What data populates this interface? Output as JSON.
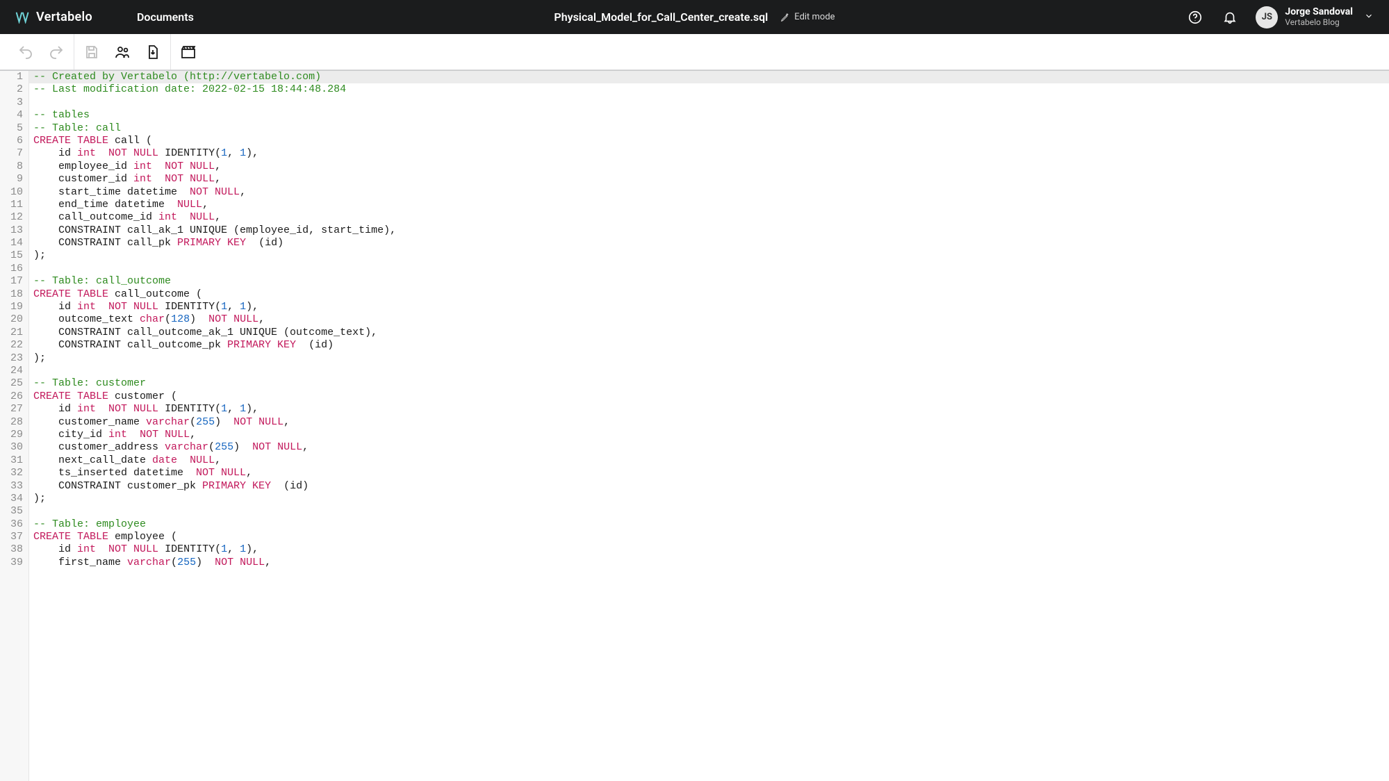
{
  "brand": "Vertabelo",
  "nav": {
    "documents": "Documents"
  },
  "header": {
    "doc_title": "Physical_Model_for_Call_Center_create.sql",
    "edit_mode_label": "Edit mode"
  },
  "user": {
    "avatar_initials": "JS",
    "name": "Jorge Sandoval",
    "subtitle": "Vertabelo Blog"
  },
  "icons": {
    "help": "help-circle-icon",
    "notifications": "bell-icon",
    "undo": "undo-icon",
    "redo": "redo-icon",
    "save": "save-icon",
    "share": "share-users-icon",
    "download": "download-icon",
    "film": "film-icon",
    "pencil": "pencil-icon",
    "chevron": "chevron-down-icon"
  },
  "editor": {
    "active_line": 1,
    "lines": [
      {
        "n": 1,
        "tokens": [
          {
            "c": "comment",
            "t": "-- Created by Vertabelo (http://vertabelo.com)"
          }
        ]
      },
      {
        "n": 2,
        "tokens": [
          {
            "c": "comment",
            "t": "-- Last modification date: 2022-02-15 18:44:48.284"
          }
        ]
      },
      {
        "n": 3,
        "tokens": [
          {
            "c": "plain",
            "t": ""
          }
        ]
      },
      {
        "n": 4,
        "tokens": [
          {
            "c": "comment",
            "t": "-- tables"
          }
        ]
      },
      {
        "n": 5,
        "tokens": [
          {
            "c": "comment",
            "t": "-- Table: call"
          }
        ]
      },
      {
        "n": 6,
        "tokens": [
          {
            "c": "keyword",
            "t": "CREATE TABLE"
          },
          {
            "c": "plain",
            "t": " call ("
          }
        ]
      },
      {
        "n": 7,
        "tokens": [
          {
            "c": "plain",
            "t": "    id "
          },
          {
            "c": "type",
            "t": "int"
          },
          {
            "c": "plain",
            "t": "  "
          },
          {
            "c": "keyword",
            "t": "NOT NULL"
          },
          {
            "c": "plain",
            "t": " IDENTITY("
          },
          {
            "c": "num",
            "t": "1"
          },
          {
            "c": "plain",
            "t": ", "
          },
          {
            "c": "num",
            "t": "1"
          },
          {
            "c": "plain",
            "t": "),"
          }
        ]
      },
      {
        "n": 8,
        "tokens": [
          {
            "c": "plain",
            "t": "    employee_id "
          },
          {
            "c": "type",
            "t": "int"
          },
          {
            "c": "plain",
            "t": "  "
          },
          {
            "c": "keyword",
            "t": "NOT NULL"
          },
          {
            "c": "plain",
            "t": ","
          }
        ]
      },
      {
        "n": 9,
        "tokens": [
          {
            "c": "plain",
            "t": "    customer_id "
          },
          {
            "c": "type",
            "t": "int"
          },
          {
            "c": "plain",
            "t": "  "
          },
          {
            "c": "keyword",
            "t": "NOT NULL"
          },
          {
            "c": "plain",
            "t": ","
          }
        ]
      },
      {
        "n": 10,
        "tokens": [
          {
            "c": "plain",
            "t": "    start_time datetime  "
          },
          {
            "c": "keyword",
            "t": "NOT NULL"
          },
          {
            "c": "plain",
            "t": ","
          }
        ]
      },
      {
        "n": 11,
        "tokens": [
          {
            "c": "plain",
            "t": "    end_time datetime  "
          },
          {
            "c": "keyword",
            "t": "NULL"
          },
          {
            "c": "plain",
            "t": ","
          }
        ]
      },
      {
        "n": 12,
        "tokens": [
          {
            "c": "plain",
            "t": "    call_outcome_id "
          },
          {
            "c": "type",
            "t": "int"
          },
          {
            "c": "plain",
            "t": "  "
          },
          {
            "c": "keyword",
            "t": "NULL"
          },
          {
            "c": "plain",
            "t": ","
          }
        ]
      },
      {
        "n": 13,
        "tokens": [
          {
            "c": "plain",
            "t": "    CONSTRAINT call_ak_1 UNIQUE (employee_id, start_time),"
          }
        ]
      },
      {
        "n": 14,
        "tokens": [
          {
            "c": "plain",
            "t": "    CONSTRAINT call_pk "
          },
          {
            "c": "keyword",
            "t": "PRIMARY KEY"
          },
          {
            "c": "plain",
            "t": "  (id)"
          }
        ]
      },
      {
        "n": 15,
        "tokens": [
          {
            "c": "plain",
            "t": ");"
          }
        ]
      },
      {
        "n": 16,
        "tokens": [
          {
            "c": "plain",
            "t": ""
          }
        ]
      },
      {
        "n": 17,
        "tokens": [
          {
            "c": "comment",
            "t": "-- Table: call_outcome"
          }
        ]
      },
      {
        "n": 18,
        "tokens": [
          {
            "c": "keyword",
            "t": "CREATE TABLE"
          },
          {
            "c": "plain",
            "t": " call_outcome ("
          }
        ]
      },
      {
        "n": 19,
        "tokens": [
          {
            "c": "plain",
            "t": "    id "
          },
          {
            "c": "type",
            "t": "int"
          },
          {
            "c": "plain",
            "t": "  "
          },
          {
            "c": "keyword",
            "t": "NOT NULL"
          },
          {
            "c": "plain",
            "t": " IDENTITY("
          },
          {
            "c": "num",
            "t": "1"
          },
          {
            "c": "plain",
            "t": ", "
          },
          {
            "c": "num",
            "t": "1"
          },
          {
            "c": "plain",
            "t": "),"
          }
        ]
      },
      {
        "n": 20,
        "tokens": [
          {
            "c": "plain",
            "t": "    outcome_text "
          },
          {
            "c": "type",
            "t": "char"
          },
          {
            "c": "plain",
            "t": "("
          },
          {
            "c": "num",
            "t": "128"
          },
          {
            "c": "plain",
            "t": ")  "
          },
          {
            "c": "keyword",
            "t": "NOT NULL"
          },
          {
            "c": "plain",
            "t": ","
          }
        ]
      },
      {
        "n": 21,
        "tokens": [
          {
            "c": "plain",
            "t": "    CONSTRAINT call_outcome_ak_1 UNIQUE (outcome_text),"
          }
        ]
      },
      {
        "n": 22,
        "tokens": [
          {
            "c": "plain",
            "t": "    CONSTRAINT call_outcome_pk "
          },
          {
            "c": "keyword",
            "t": "PRIMARY KEY"
          },
          {
            "c": "plain",
            "t": "  (id)"
          }
        ]
      },
      {
        "n": 23,
        "tokens": [
          {
            "c": "plain",
            "t": ");"
          }
        ]
      },
      {
        "n": 24,
        "tokens": [
          {
            "c": "plain",
            "t": ""
          }
        ]
      },
      {
        "n": 25,
        "tokens": [
          {
            "c": "comment",
            "t": "-- Table: customer"
          }
        ]
      },
      {
        "n": 26,
        "tokens": [
          {
            "c": "keyword",
            "t": "CREATE TABLE"
          },
          {
            "c": "plain",
            "t": " customer ("
          }
        ]
      },
      {
        "n": 27,
        "tokens": [
          {
            "c": "plain",
            "t": "    id "
          },
          {
            "c": "type",
            "t": "int"
          },
          {
            "c": "plain",
            "t": "  "
          },
          {
            "c": "keyword",
            "t": "NOT NULL"
          },
          {
            "c": "plain",
            "t": " IDENTITY("
          },
          {
            "c": "num",
            "t": "1"
          },
          {
            "c": "plain",
            "t": ", "
          },
          {
            "c": "num",
            "t": "1"
          },
          {
            "c": "plain",
            "t": "),"
          }
        ]
      },
      {
        "n": 28,
        "tokens": [
          {
            "c": "plain",
            "t": "    customer_name "
          },
          {
            "c": "type",
            "t": "varchar"
          },
          {
            "c": "plain",
            "t": "("
          },
          {
            "c": "num",
            "t": "255"
          },
          {
            "c": "plain",
            "t": ")  "
          },
          {
            "c": "keyword",
            "t": "NOT NULL"
          },
          {
            "c": "plain",
            "t": ","
          }
        ]
      },
      {
        "n": 29,
        "tokens": [
          {
            "c": "plain",
            "t": "    city_id "
          },
          {
            "c": "type",
            "t": "int"
          },
          {
            "c": "plain",
            "t": "  "
          },
          {
            "c": "keyword",
            "t": "NOT NULL"
          },
          {
            "c": "plain",
            "t": ","
          }
        ]
      },
      {
        "n": 30,
        "tokens": [
          {
            "c": "plain",
            "t": "    customer_address "
          },
          {
            "c": "type",
            "t": "varchar"
          },
          {
            "c": "plain",
            "t": "("
          },
          {
            "c": "num",
            "t": "255"
          },
          {
            "c": "plain",
            "t": ")  "
          },
          {
            "c": "keyword",
            "t": "NOT NULL"
          },
          {
            "c": "plain",
            "t": ","
          }
        ]
      },
      {
        "n": 31,
        "tokens": [
          {
            "c": "plain",
            "t": "    next_call_date "
          },
          {
            "c": "type",
            "t": "date"
          },
          {
            "c": "plain",
            "t": "  "
          },
          {
            "c": "keyword",
            "t": "NULL"
          },
          {
            "c": "plain",
            "t": ","
          }
        ]
      },
      {
        "n": 32,
        "tokens": [
          {
            "c": "plain",
            "t": "    ts_inserted datetime  "
          },
          {
            "c": "keyword",
            "t": "NOT NULL"
          },
          {
            "c": "plain",
            "t": ","
          }
        ]
      },
      {
        "n": 33,
        "tokens": [
          {
            "c": "plain",
            "t": "    CONSTRAINT customer_pk "
          },
          {
            "c": "keyword",
            "t": "PRIMARY KEY"
          },
          {
            "c": "plain",
            "t": "  (id)"
          }
        ]
      },
      {
        "n": 34,
        "tokens": [
          {
            "c": "plain",
            "t": ");"
          }
        ]
      },
      {
        "n": 35,
        "tokens": [
          {
            "c": "plain",
            "t": ""
          }
        ]
      },
      {
        "n": 36,
        "tokens": [
          {
            "c": "comment",
            "t": "-- Table: employee"
          }
        ]
      },
      {
        "n": 37,
        "tokens": [
          {
            "c": "keyword",
            "t": "CREATE TABLE"
          },
          {
            "c": "plain",
            "t": " employee ("
          }
        ]
      },
      {
        "n": 38,
        "tokens": [
          {
            "c": "plain",
            "t": "    id "
          },
          {
            "c": "type",
            "t": "int"
          },
          {
            "c": "plain",
            "t": "  "
          },
          {
            "c": "keyword",
            "t": "NOT NULL"
          },
          {
            "c": "plain",
            "t": " IDENTITY("
          },
          {
            "c": "num",
            "t": "1"
          },
          {
            "c": "plain",
            "t": ", "
          },
          {
            "c": "num",
            "t": "1"
          },
          {
            "c": "plain",
            "t": "),"
          }
        ]
      },
      {
        "n": 39,
        "tokens": [
          {
            "c": "plain",
            "t": "    first_name "
          },
          {
            "c": "type",
            "t": "varchar"
          },
          {
            "c": "plain",
            "t": "("
          },
          {
            "c": "num",
            "t": "255"
          },
          {
            "c": "plain",
            "t": ")  "
          },
          {
            "c": "keyword",
            "t": "NOT NULL"
          },
          {
            "c": "plain",
            "t": ","
          }
        ]
      }
    ]
  }
}
